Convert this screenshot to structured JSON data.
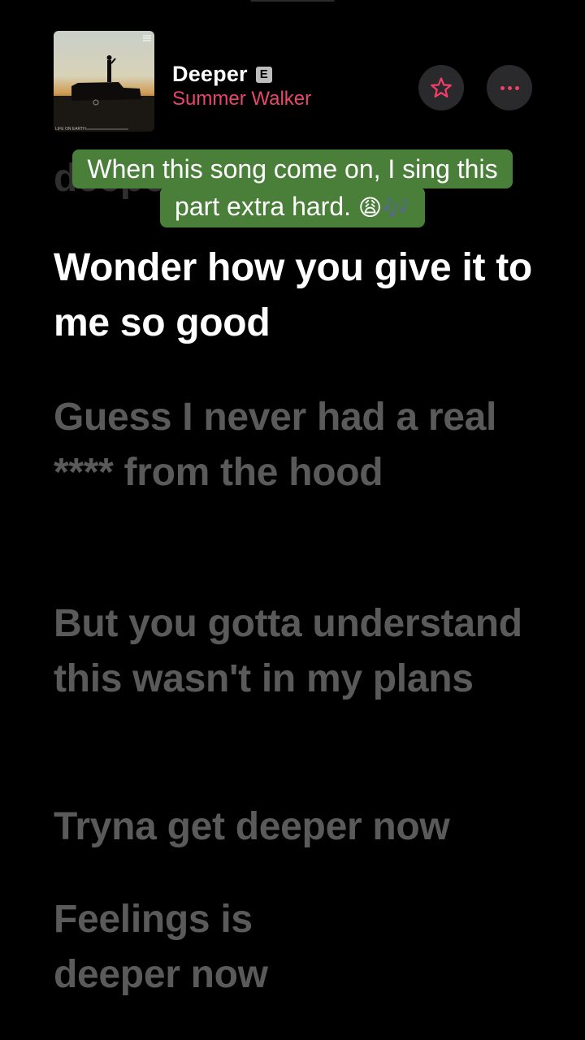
{
  "player": {
    "song_title": "Deeper",
    "explicit_label": "E",
    "artist": "Summer Walker",
    "album_art_text": "LIFE ON EARTH",
    "favorite_icon": "star-icon",
    "more_icon": "ellipsis-icon"
  },
  "caption": {
    "line1": "When this song come on, I sing this",
    "line2_text": "part extra hard. ",
    "line2_emoji": "😩🎶",
    "background_color": "#4a7f3a"
  },
  "lyrics": {
    "past": "deeper now",
    "active": "Wonder how you give it to me so good",
    "upcoming": [
      "Guess I never had a real **** from the hood",
      "But you gotta understand this wasn't in my plans",
      "Tryna get deeper now",
      "Feelings is deeper now"
    ]
  },
  "colors": {
    "artist": "#e8476a",
    "accent": "#ef3f68",
    "active_lyric": "#ffffff",
    "upcoming_lyric": "#5a5a5a"
  }
}
